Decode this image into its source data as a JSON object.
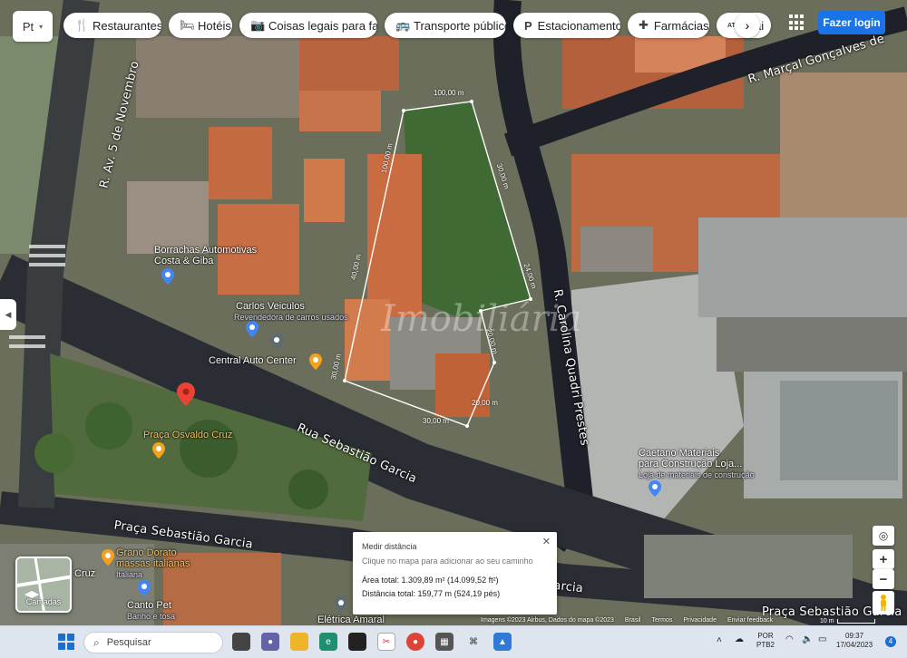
{
  "lang_selector": {
    "label": "Pt",
    "caret": "▾"
  },
  "chips": [
    {
      "icon": "🍴",
      "label": "Restaurantes",
      "width": 108
    },
    {
      "icon": "🛏",
      "label": "Hotéis",
      "width": 70
    },
    {
      "icon": "📷",
      "label": "Coisas legais para faz...",
      "width": 152
    },
    {
      "icon": "🚌",
      "label": "Transporte público",
      "width": 134
    },
    {
      "icon": "P",
      "label": "Estacionamento",
      "width": 118
    },
    {
      "icon": "✚",
      "label": "Farmácias",
      "width": 90
    },
    {
      "icon": "ATM",
      "label": "Cai",
      "width": 60
    }
  ],
  "chip_next": "›",
  "login": {
    "label": "Fazer login"
  },
  "streets": [
    {
      "text": "R. Av. 5 de Novembro"
    },
    {
      "text": "R. Marçal Gonçalves de"
    },
    {
      "text": "R. Carolina Quadri Prestes"
    },
    {
      "text": "Rua Sebastião Garcia"
    },
    {
      "text": "Praça Sebastião Garcia"
    },
    {
      "text": "Praça Sebastião Garcia"
    },
    {
      "text": "Garcia"
    }
  ],
  "pois": [
    {
      "title": "Borrachas Automotivas",
      "title2": "Costa & Giba",
      "sub": ""
    },
    {
      "title": "Carlos Veiculos",
      "title2": "",
      "sub": "Revendedora de carros usados"
    },
    {
      "title": "Central Auto Center",
      "title2": "",
      "sub": ""
    },
    {
      "title": "Praça Osvaldo Cruz",
      "title2": "",
      "sub": ""
    },
    {
      "title": "Caetano Materiais",
      "title2": "para Construção Loja...",
      "sub": "Loja de materiais de construção"
    },
    {
      "title": "Grano Dorato",
      "title2": "massas italianas",
      "sub": "Italiana"
    },
    {
      "title": "Canto Pet",
      "title2": "",
      "sub": "Banho e tosa"
    },
    {
      "title": "Elétrica Amaral",
      "title2": "",
      "sub": ""
    },
    {
      "title": "Cruz",
      "title2": "",
      "sub": ""
    }
  ],
  "measure_labels": [
    "100,00 m",
    "100,00 m",
    "30,00 m",
    "40,00 m",
    "24,00 m",
    "20,00 m",
    "30,00 m",
    "30,00 m",
    "20,00 m"
  ],
  "watermark": "Imobiliária",
  "measure_panel": {
    "title": "Medir distância",
    "hint": "Clique no mapa para adicionar ao seu caminho",
    "area": "Área total: 1.309,89 m² (14.099,52 ft²)",
    "distance": "Distância total: 159,77 m (524,19 pés)",
    "close": "✕"
  },
  "layers": {
    "label": "Camadas"
  },
  "zoom": {
    "in": "+",
    "out": "−"
  },
  "attribution": [
    "Imagens ©2023 Airbus, Dados do mapa ©2023",
    "Brasil",
    "Termos",
    "Privacidade",
    "Enviar feedback"
  ],
  "scale": "10 m",
  "taskbar": {
    "search_placeholder": "Pesquisar",
    "lang": "POR",
    "lang2": "PTB2",
    "time": "09:37",
    "date": "17/04/2023",
    "notif_count": "4"
  },
  "colors": {
    "accent": "#1a73e8",
    "measure_line": "#ffffff",
    "pin_red": "#ea4335",
    "pin_blue": "#4285f4",
    "pin_orange": "#f4a11d"
  }
}
